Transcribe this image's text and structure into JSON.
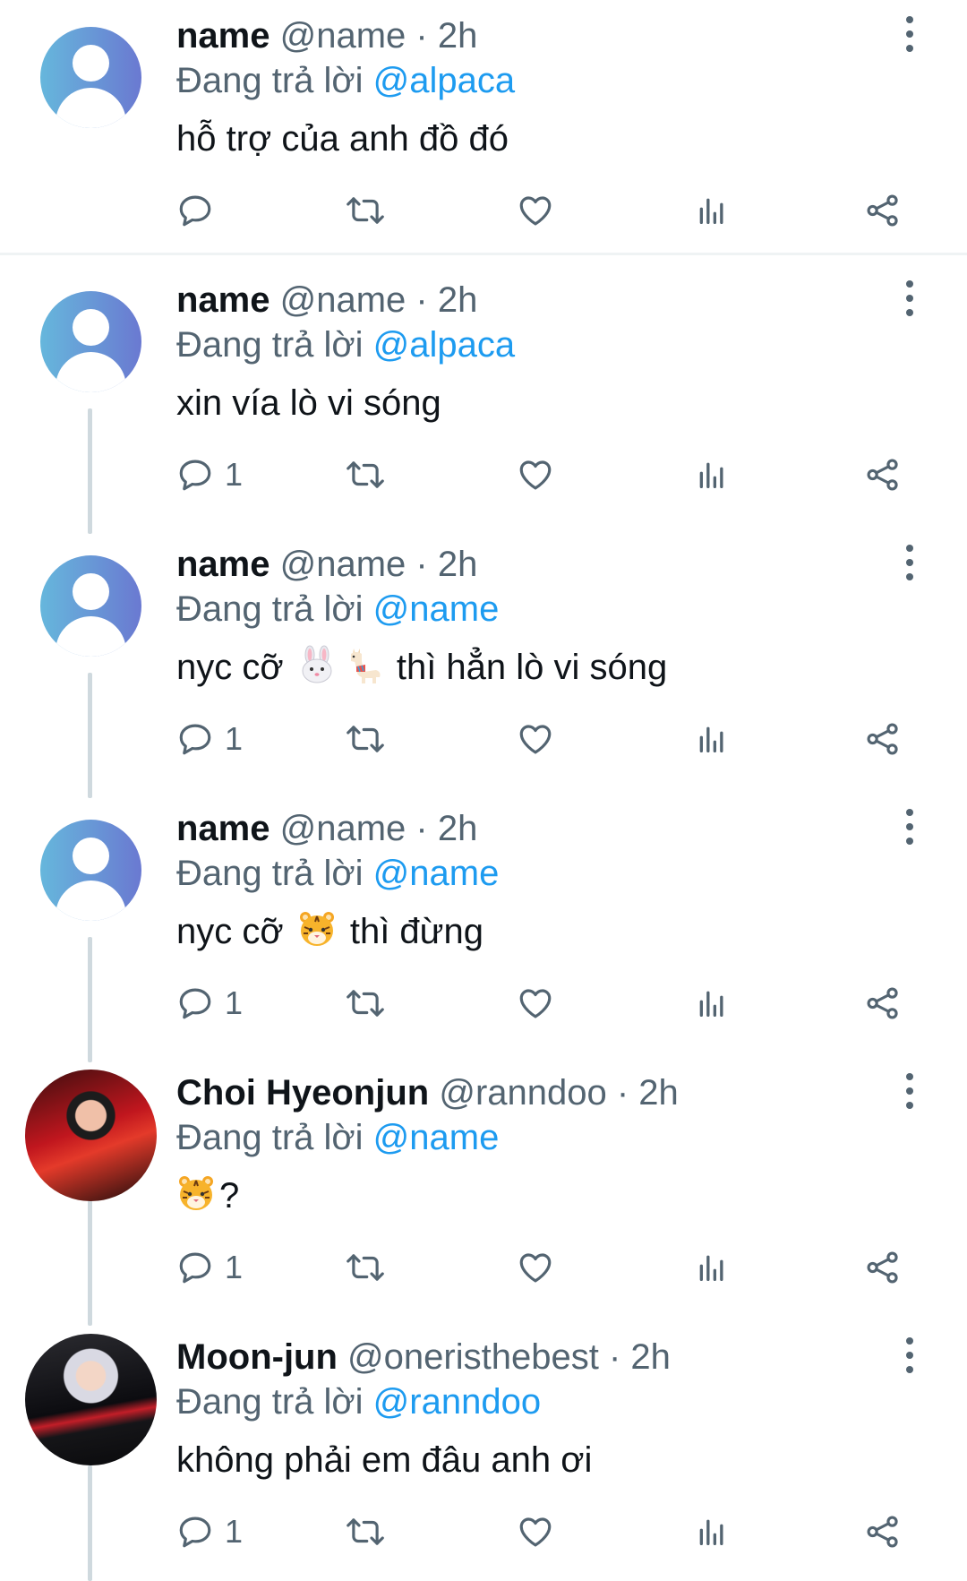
{
  "reply_prefix": "Đang trả lời",
  "tweets": [
    {
      "name": "name",
      "handle": "@name",
      "time": "· 2h",
      "reply_to": "@alpaca",
      "text": "hỗ trợ của anh đồ đó",
      "reply_count": "",
      "avatar": "default-avatar"
    },
    {
      "name": "name",
      "handle": "@name",
      "time": "· 2h",
      "reply_to": "@alpaca",
      "text": "xin vía lò vi sóng",
      "reply_count": "1",
      "avatar": "default-avatar"
    },
    {
      "name": "name",
      "handle": "@name",
      "time": "· 2h",
      "reply_to": "@name",
      "text_before": "nyc cỡ",
      "text_after": "thì hẳn lò vi sóng",
      "emojis": [
        "rabbit-face-emoji",
        "llama-emoji"
      ],
      "reply_count": "1",
      "avatar": "default-avatar"
    },
    {
      "name": "name",
      "handle": "@name",
      "time": "· 2h",
      "reply_to": "@name",
      "text_before": "nyc cỡ",
      "text_after": "thì đừng",
      "emojis": [
        "tiger-face-emoji"
      ],
      "reply_count": "1",
      "avatar": "default-avatar"
    },
    {
      "name": "Choi Hyeonjun",
      "handle": "@ranndoo",
      "time": "· 2h",
      "reply_to": "@name",
      "text_after": "?",
      "emojis": [
        "tiger-face-emoji"
      ],
      "reply_count": "1",
      "avatar": "photo-avatar"
    },
    {
      "name": "Moon-jun",
      "handle": "@oneristhebest",
      "time": "· 2h",
      "reply_to": "@ranndoo",
      "text": "không phải em đâu anh ơi",
      "reply_count": "1",
      "avatar": "photo-avatar"
    }
  ],
  "colors": {
    "link": "#1d9bf0",
    "secondary_text": "#536471",
    "primary_text": "#0f1419",
    "thread_line": "#cfd9de"
  },
  "icons": [
    "reply-icon",
    "retweet-icon",
    "like-icon",
    "views-icon",
    "share-icon",
    "more-icon"
  ]
}
